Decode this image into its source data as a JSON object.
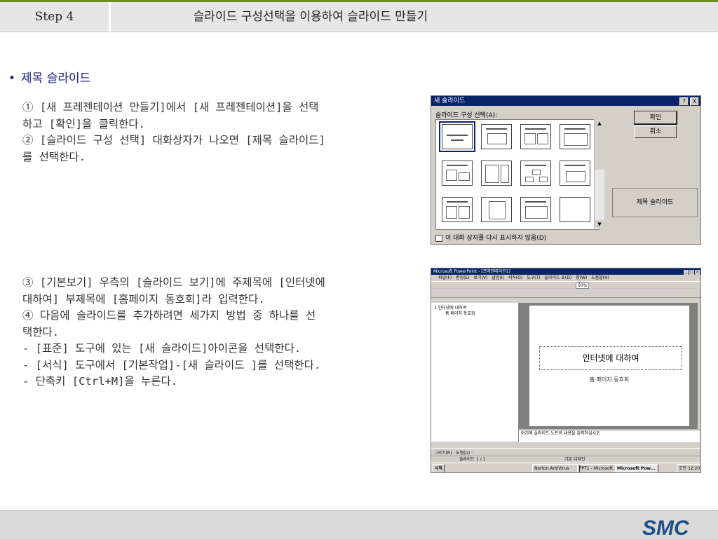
{
  "header": {
    "step": "Step 4",
    "title": "슬라이드 구성선택을 이용하여 슬라이드 만들기"
  },
  "bullet": {
    "marker": "•",
    "label": "제목 슬라이드"
  },
  "paragraph1": [
    "① [새 프레젠테이션 만들기]에서 [새 프레젠테이션]을 선택",
    "하고 [확인]을 클릭한다.",
    "② [슬라이드 구성 선택] 대화상자가 나오면 [제목 슬라이드]",
    "를 선택한다."
  ],
  "paragraph2": [
    "③ [기본보기] 우측의 [슬라이드 보기]에 주제목에 [인터넷에",
    "대하여] 부제목에 [홈페이지 동호회]라 입력한다.",
    "④ 다음에 슬라이드를 추가하려면 세가지 방법 중 하나를 선",
    "택한다.",
    "- [표준] 도구에 있는 [새 슬라이드]아이콘을 선택한다.",
    "- [서식] 도구에서 [기본작업]-[새 슬라이드 ]를 선택한다.",
    "- 단축키 [Ctrl+M]을 누른다."
  ],
  "dialog": {
    "title": "새 슬라이드",
    "help_btn": "?",
    "close_btn": "X",
    "layout_label": "슬라이드 구성 선택(A):",
    "ok_label": "확인",
    "cancel_label": "취소",
    "preview_label": "제목 슬라이드",
    "checkbox_label": "이 대화 상자를 다시 표시하지 않음(D)",
    "scroll_up": "▲",
    "scroll_down": "▼"
  },
  "powerpoint": {
    "title": "Microsoft PowerPoint - [프레젠테이션1]",
    "menu": [
      "파일(F)",
      "편집(E)",
      "보기(V)",
      "삽입(I)",
      "서식(O)",
      "도구(T)",
      "슬라이드 쇼(D)",
      "창(W)",
      "도움말(H)"
    ],
    "zoom": "50%",
    "outline_title": "1 인터넷에 대하여",
    "outline_sub": "홈 페이지 동호회",
    "slide_title": "인터넷에 대하여",
    "slide_subtitle": "홈 페이지 동호회",
    "notes": "여기에 슬라이드 노트의 내용을 입력하십시오",
    "draw_label": "그리기(R) ·  도형(U) ·",
    "status_slide": "슬라이드 1 / 1",
    "status_design": "기본 디자인",
    "taskbar_start": "시작",
    "taskbar_items": [
      "Norton AntiVirus",
      "PPT1 - Microsoft ...",
      "Microsoft Pow..."
    ],
    "taskbar_time": "오전 12:20"
  },
  "footer": {
    "logo_text": "SMC"
  }
}
